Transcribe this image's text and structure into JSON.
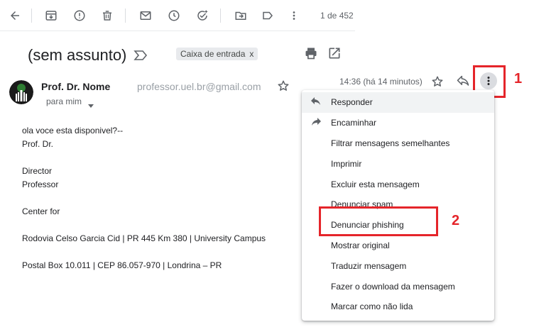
{
  "toolbar": {
    "icons": [
      "back-arrow-icon",
      "archive-icon",
      "report-spam-icon",
      "delete-icon",
      "mark-unread-icon",
      "snooze-icon",
      "add-to-tasks-icon",
      "move-to-icon",
      "label-icon",
      "more-vertical-icon"
    ],
    "pager": "1 de 452"
  },
  "email": {
    "subject": "(sem assunto)",
    "label_chip": "Caixa de entrada",
    "label_remove": "x",
    "sender_name": "Prof. Dr. Nome",
    "sender_email": "professor.uel.br@gmail.com",
    "recipient": "para mim",
    "time": "14:36 (há 14 minutos)",
    "body": {
      "line1": "ola voce esta disponivel?--",
      "line2": "Prof. Dr.",
      "line3": "Director",
      "line4": "Professor",
      "line5": "Center for",
      "line6": "Rodovia Celso Garcia Cid | PR 445 Km 380 | University Campus",
      "line7": "Postal Box 10.011 | CEP 86.057-970 | Londrina – PR"
    }
  },
  "menu": {
    "items": [
      {
        "label": "Responder",
        "icon": "reply-icon"
      },
      {
        "label": "Encaminhar",
        "icon": "forward-icon"
      },
      {
        "label": "Filtrar mensagens semelhantes"
      },
      {
        "label": "Imprimir"
      },
      {
        "label": "Excluir esta mensagem"
      },
      {
        "label": "Denunciar spam"
      },
      {
        "label": "Denunciar phishing"
      },
      {
        "label": "Mostrar original"
      },
      {
        "label": "Traduzir mensagem"
      },
      {
        "label": "Fazer o download da mensagem"
      },
      {
        "label": "Marcar como não lida"
      }
    ]
  },
  "annotations": {
    "step1": "1",
    "step2": "2",
    "color": "#e5252a"
  }
}
